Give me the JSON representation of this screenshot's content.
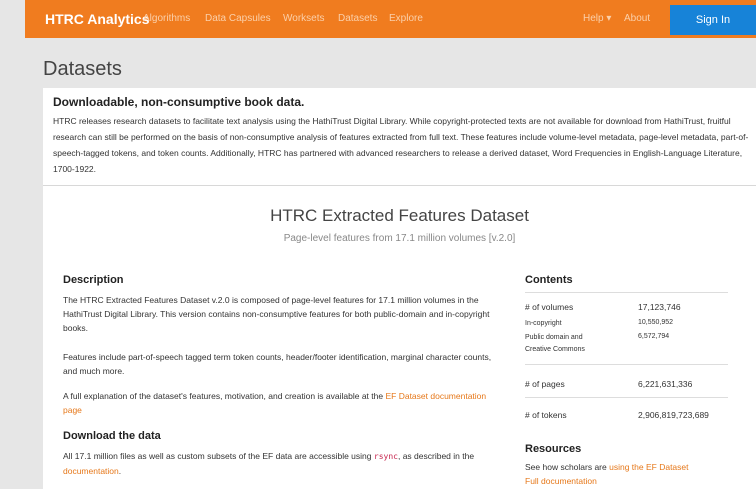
{
  "nav": {
    "brand": "HTRC Analytics",
    "links": [
      "Algorithms",
      "Data Capsules",
      "Worksets",
      "Datasets",
      "Explore"
    ],
    "help": "Help ▾",
    "about": "About",
    "sign_in": "Sign In"
  },
  "page_title": "Datasets",
  "intro": {
    "heading": "Downloadable, non-consumptive book data.",
    "text": "HTRC releases research datasets to facilitate text analysis using the HathiTrust Digital Library. While copyright-protected texts are not available for download from HathiTrust, fruitful research can still be performed on the basis of non-consumptive analysis of features extracted from full text. These features include volume-level metadata, page-level metadata, part-of-speech-tagged tokens, and token counts. Additionally, HTRC has partnered with advanced researchers to release a derived dataset, Word Frequencies in English-Language Literature, 1700-1922."
  },
  "dataset": {
    "title": "HTRC Extracted Features Dataset",
    "subtitle": "Page-level features from 17.1 million volumes [v.2.0]",
    "description_heading": "Description",
    "desc_p1": "The HTRC Extracted Features Dataset v.2.0 is composed of page-level features for 17.1 million volumes in the HathiTrust Digital Library. This version contains non-consumptive features for both public-domain and in-copyright books.",
    "desc_p2": "Features include part-of-speech tagged term token counts, header/footer identification, marginal character counts, and much more.",
    "desc_p3_pre": "A full explanation of the dataset's features, motivation, and creation is available at the",
    "desc_p3_link": "EF Dataset documentation page",
    "download_heading": "Download the data",
    "download_pre": "All 17.1 million files as well as custom subsets of the EF data are accessible using",
    "download_code": "rsync",
    "download_mid": ", as described in the",
    "download_link": "documentation",
    "download_end": "."
  },
  "contents": {
    "heading": "Contents",
    "volumes_label": "# of volumes",
    "volumes_value": "17,123,746",
    "incopyright_label": "In-copyright",
    "incopyright_value": "10,550,952",
    "public_label_1": "Public domain and",
    "public_label_2": "Creative Commons",
    "public_value": "6,572,794",
    "pages_label": "# of pages",
    "pages_value": "6,221,631,336",
    "tokens_label": "# of tokens",
    "tokens_value": "2,906,819,723,689"
  },
  "resources": {
    "heading": "Resources",
    "text_pre": "See how scholars are",
    "link1": "using the EF Dataset",
    "link2": "Full documentation"
  },
  "colors": {
    "brand": "#f07c1f",
    "sign_in": "#1783d8",
    "link": "#e6781a"
  }
}
